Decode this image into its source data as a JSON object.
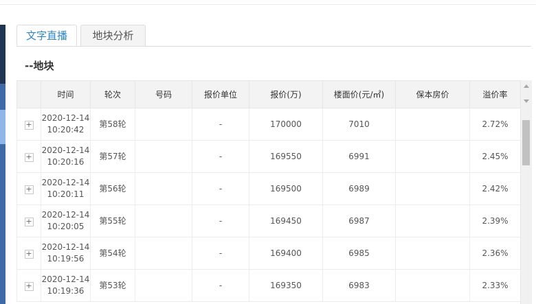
{
  "tabs": [
    {
      "label": "文字直播",
      "active": true
    },
    {
      "label": "地块分析",
      "active": false
    }
  ],
  "section": {
    "title": "--地块"
  },
  "table": {
    "columns": [
      "",
      "时间",
      "轮次",
      "号码",
      "报价单位",
      "报价(万)",
      "楼面价(元/㎡)",
      "保本房价",
      "溢价率"
    ],
    "rows": [
      {
        "expand": "+",
        "date": "2020-12-14",
        "time": "10:20:42",
        "round": "第58轮",
        "number": "",
        "unit": "-",
        "price": "170000",
        "floor_price": "7010",
        "breakeven": "",
        "premium": "2.72%"
      },
      {
        "expand": "+",
        "date": "2020-12-14",
        "time": "10:20:16",
        "round": "第57轮",
        "number": "",
        "unit": "-",
        "price": "169550",
        "floor_price": "6991",
        "breakeven": "",
        "premium": "2.45%"
      },
      {
        "expand": "+",
        "date": "2020-12-14",
        "time": "10:20:11",
        "round": "第56轮",
        "number": "",
        "unit": "-",
        "price": "169500",
        "floor_price": "6989",
        "breakeven": "",
        "premium": "2.42%"
      },
      {
        "expand": "+",
        "date": "2020-12-14",
        "time": "10:20:05",
        "round": "第55轮",
        "number": "",
        "unit": "-",
        "price": "169450",
        "floor_price": "6987",
        "breakeven": "",
        "premium": "2.39%"
      },
      {
        "expand": "+",
        "date": "2020-12-14",
        "time": "10:19:56",
        "round": "第54轮",
        "number": "",
        "unit": "-",
        "price": "169400",
        "floor_price": "6985",
        "breakeven": "",
        "premium": "2.36%"
      },
      {
        "expand": "+",
        "date": "2020-12-14",
        "time": "10:19:36",
        "round": "第53轮",
        "number": "",
        "unit": "-",
        "price": "169350",
        "floor_price": "6983",
        "breakeven": "",
        "premium": "2.33%"
      }
    ]
  },
  "colors": {
    "accent": "#2e86c9",
    "sidebar": "#3f6aa8",
    "header_bg": "#f3f3f3"
  }
}
